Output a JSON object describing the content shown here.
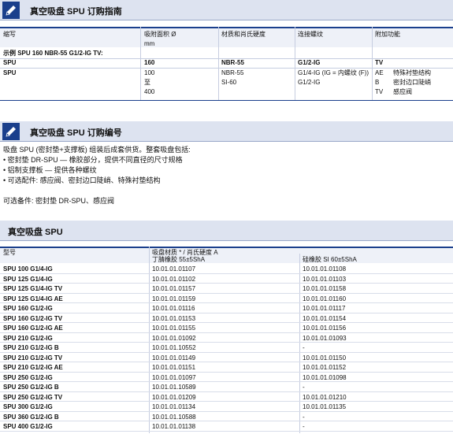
{
  "section1": {
    "title": "真空吸盘 SPU 订购指南",
    "headers": [
      "缩写",
      "吸附面积 Ø\nmm",
      "材质和肖氏硬度",
      "连接螺纹",
      "附加功能"
    ],
    "example_label": "示例 SPU 160 NBR-55 G1/2-IG TV:",
    "example_values": [
      "SPU",
      "160",
      "NBR-55",
      "G1/2-IG",
      "TV"
    ],
    "options": {
      "abbr": "SPU",
      "diameters": [
        "100",
        "至",
        "400"
      ],
      "materials": [
        "NBR-55",
        "SI-60"
      ],
      "threads": [
        "G1/4-IG (IG = 内螺纹 (F))",
        "G1/2-IG"
      ],
      "extras": [
        {
          "code": "AE",
          "desc": "特殊衬垫结构"
        },
        {
          "code": "B",
          "desc": "密封边口陡峭"
        },
        {
          "code": "TV",
          "desc": "感应阀"
        }
      ]
    }
  },
  "section2": {
    "title": "真空吸盘 SPU 订购编号",
    "lines": [
      "吸盘 SPU (密封垫+支撑板) 组装后成套供货。整套吸盘包括:",
      "• 密封垫 DR-SPU — 橡胶部分，提供不同直径的尺寸规格",
      "• 铝制支撑板 — 提供各种螺纹",
      "• 可选配件: 感应阀、密封边口陡峭、特殊衬垫结构",
      "",
      "可选备件: 密封垫 DR-SPU、感应阀"
    ]
  },
  "section3": {
    "title": "真空吸盘 SPU",
    "col_type": "型号",
    "col_material": "吸盘材质 * / 肖氏硬度 A",
    "col_nbr": "丁腈橡胶 55±5ShA",
    "col_si": "硅橡胶 SI 60±5ShA",
    "rows": [
      [
        "SPU 100 G1/4-IG",
        "10.01.01.01107",
        "10.01.01.01108"
      ],
      [
        "SPU 125 G1/4-IG",
        "10.01.01.01102",
        "10.01.01.01103"
      ],
      [
        "SPU 125 G1/4-IG TV",
        "10.01.01.01157",
        "10.01.01.01158"
      ],
      [
        "SPU 125 G1/4-IG AE",
        "10.01.01.01159",
        "10.01.01.01160"
      ],
      [
        "SPU 160 G1/2-IG",
        "10.01.01.01116",
        "10.01.01.01117"
      ],
      [
        "SPU 160 G1/2-IG TV",
        "10.01.01.01153",
        "10.01.01.01154"
      ],
      [
        "SPU 160 G1/2-IG AE",
        "10.01.01.01155",
        "10.01.01.01156"
      ],
      [
        "SPU 210 G1/2-IG",
        "10.01.01.01092",
        "10.01.01.01093"
      ],
      [
        "SPU 210 G1/2-IG B",
        "10.01.01.10552",
        "-"
      ],
      [
        "SPU 210 G1/2-IG TV",
        "10.01.01.01149",
        "10.01.01.01150"
      ],
      [
        "SPU 210 G1/2-IG AE",
        "10.01.01.01151",
        "10.01.01.01152"
      ],
      [
        "SPU 250 G1/2-IG",
        "10.01.01.01097",
        "10.01.01.01098"
      ],
      [
        "SPU 250 G1/2-IG B",
        "10.01.01.10589",
        "-"
      ],
      [
        "SPU 250 G1/2-IG TV",
        "10.01.01.01209",
        "10.01.01.01210"
      ],
      [
        "SPU 300 G1/2-IG",
        "10.01.01.01134",
        "10.01.01.01135"
      ],
      [
        "SPU 360 G1/2-IG B",
        "10.01.01.10588",
        "-"
      ],
      [
        "SPU 400 G1/2-IG",
        "10.01.01.01138",
        "-"
      ]
    ]
  },
  "colors": {
    "accent": "#1a3f8c",
    "header_bg": "#dde3f0"
  },
  "icons": [
    "pencil-icon"
  ]
}
